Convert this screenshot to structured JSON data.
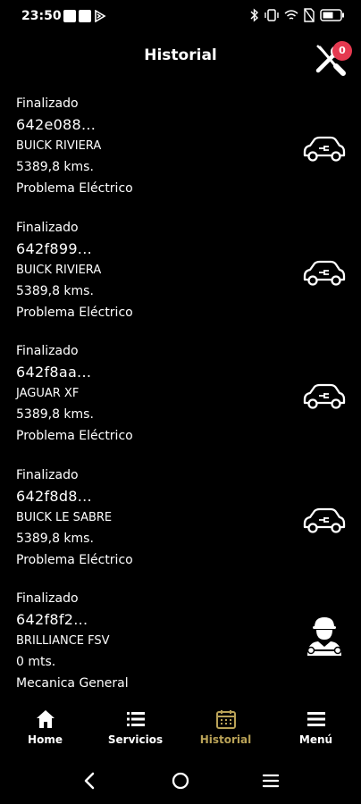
{
  "status_bar": {
    "time": "23:50",
    "icons": [
      "square",
      "square",
      "play-triangle",
      "bluetooth",
      "vibrate",
      "wifi",
      "no-sim",
      "battery"
    ]
  },
  "header": {
    "title": "Historial",
    "tools_badge": "0"
  },
  "history": [
    {
      "status": "Finalizado",
      "id": "642e088...",
      "vehicle": "BUICK RIVIERA",
      "distance": "5389,8 kms.",
      "problem": "Problema Eléctrico",
      "icon": "car-electric-icon"
    },
    {
      "status": "Finalizado",
      "id": "642f899...",
      "vehicle": "BUICK RIVIERA",
      "distance": "5389,8 kms.",
      "problem": "Problema Eléctrico",
      "icon": "car-electric-icon"
    },
    {
      "status": "Finalizado",
      "id": "642f8aa...",
      "vehicle": "JAGUAR XF",
      "distance": "5389,8 kms.",
      "problem": "Problema Eléctrico",
      "icon": "car-electric-icon"
    },
    {
      "status": "Finalizado",
      "id": "642f8d8...",
      "vehicle": "BUICK LE SABRE",
      "distance": "5389,8 kms.",
      "problem": "Problema Eléctrico",
      "icon": "car-electric-icon"
    },
    {
      "status": "Finalizado",
      "id": "642f8f2...",
      "vehicle": "BRILLIANCE FSV",
      "distance": "0 mts.",
      "problem": "Mecanica General",
      "icon": "mechanic-icon"
    }
  ],
  "bottom_nav": {
    "items": [
      {
        "label": "Home",
        "icon": "home-icon"
      },
      {
        "label": "Servicios",
        "icon": "list-icon"
      },
      {
        "label": "Historial",
        "icon": "calendar-icon",
        "active": true
      },
      {
        "label": "Menú",
        "icon": "menu-icon"
      }
    ]
  },
  "colors": {
    "background": "#000000",
    "text": "#ffffff",
    "active": "#b9a257",
    "badge": "#e53950"
  }
}
